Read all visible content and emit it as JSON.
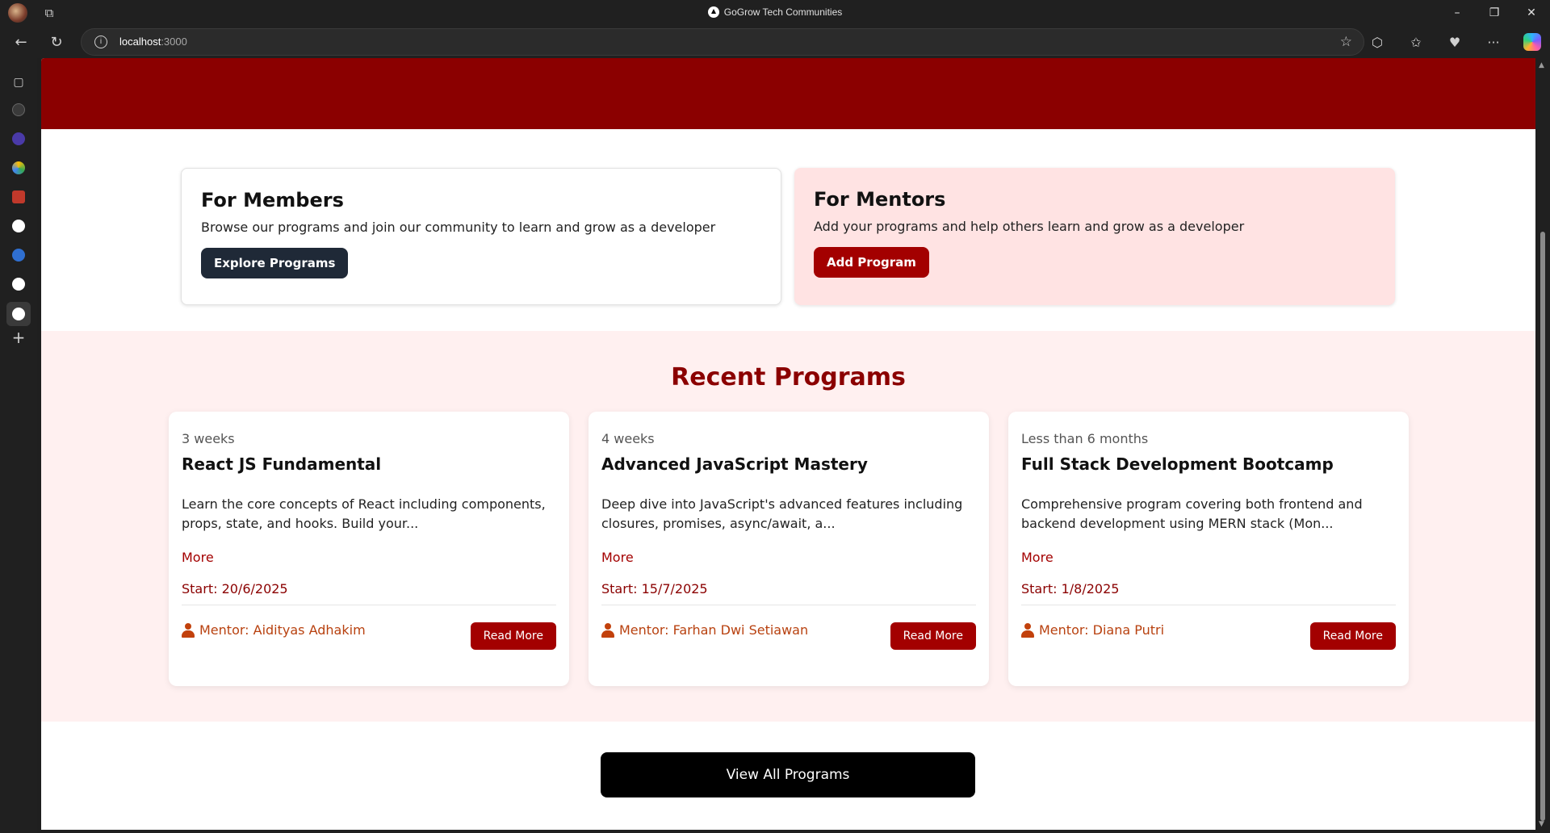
{
  "browser": {
    "window_title": "GoGrow Tech Communities",
    "url_host": "localhost",
    "url_port": ":3000"
  },
  "members": {
    "title": "For Members",
    "description": "Browse our programs and join our community to learn and grow as a developer",
    "button": "Explore Programs"
  },
  "mentors": {
    "title": "For Mentors",
    "description": "Add your programs and help others learn and grow as a developer",
    "button": "Add Program"
  },
  "recent": {
    "title": "Recent Programs",
    "programs": [
      {
        "duration": "3 weeks",
        "title": "React JS Fundamental",
        "description": "Learn the core concepts of React including components, props, state, and hooks. Build your...",
        "more": "More",
        "start": "Start: 20/6/2025",
        "mentor": "Mentor: Aidityas Adhakim",
        "button": "Read More"
      },
      {
        "duration": "4 weeks",
        "title": "Advanced JavaScript Mastery",
        "description": "Deep dive into JavaScript's advanced features including closures, promises, async/await, a...",
        "more": "More",
        "start": "Start: 15/7/2025",
        "mentor": "Mentor: Farhan Dwi Setiawan",
        "button": "Read More"
      },
      {
        "duration": "Less than 6 months",
        "title": "Full Stack Development Bootcamp",
        "description": "Comprehensive program covering both frontend and backend development using MERN stack (Mon...",
        "more": "More",
        "start": "Start: 1/8/2025",
        "mentor": "Mentor: Diana Putri",
        "button": "Read More"
      }
    ]
  },
  "view_all": "View All Programs",
  "colors": {
    "hero": "#8b0000",
    "accent": "#a30000",
    "dark_button": "#1f2937",
    "mentor_card_bg": "#ffe3e3",
    "recent_bg": "#fff0f0"
  }
}
